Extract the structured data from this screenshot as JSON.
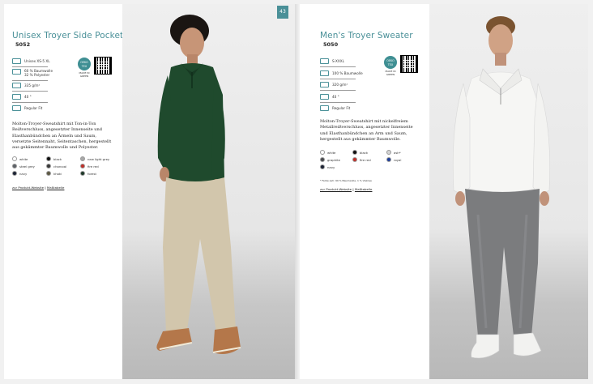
{
  "left_page": {
    "page_number": "43",
    "title": "Unisex Troyer Side Pocket",
    "code": "5052",
    "specs": [
      "Unisex XS-5 XL",
      "60 % Baumwolle 32 % Polyester",
      "335 g/m²",
      "40 °",
      "Regular Fit"
    ],
    "badge": "OEKO TEX",
    "badge_sub": "MADE IN GREEN",
    "description": "Molton-Troyer-Sweatshirt mit Ton-in-Ton Reißverschluss, angesetzter Innenseite und Elasthanbündchen an Ärmeln und Saum, versetzte Seitennaht, Seitentaschen, hergestellt aus gekämmter Baumwolle und Polyester.",
    "colors": [
      {
        "name": "white",
        "hex": "#ffffff"
      },
      {
        "name": "black",
        "hex": "#111111"
      },
      {
        "name": "new light grey",
        "hex": "#a8a8a8"
      },
      {
        "name": "steel grey",
        "hex": "#5e6268"
      },
      {
        "name": "charcoal",
        "hex": "#3a3a3a"
      },
      {
        "name": "fire red",
        "hex": "#c0302a"
      },
      {
        "name": "navy",
        "hex": "#1d2436"
      },
      {
        "name": "khaki",
        "hex": "#5e5a44"
      },
      {
        "name": "forest",
        "hex": "#1f3a2a"
      }
    ],
    "link_product": "zur Produkt-Website",
    "link_sep": "|",
    "link_size": "Maßtabelle"
  },
  "right_page": {
    "page_number": "44",
    "title": "Men's Troyer Sweater",
    "code": "5050",
    "specs": [
      "S-XXXL",
      "100 % Baumwolle",
      "320 g/m²",
      "40 °",
      "Regular Fit"
    ],
    "badge": "OEKO TEX",
    "badge_sub": "MADE IN GREEN",
    "description": "Molton-Troyer-Sweatshirt mit nickelfreiem Metallreißverschluss, angesetzter Innenseite und Elasthanbündchen an Arm und Saum, hergestellt aus gekämmter Baumwolle.",
    "colors": [
      {
        "name": "white",
        "hex": "#ffffff"
      },
      {
        "name": "black",
        "hex": "#111111"
      },
      {
        "name": "ash*",
        "hex": "#d4d4d4"
      },
      {
        "name": "graphite",
        "hex": "#4a4c50"
      },
      {
        "name": "fire red",
        "hex": "#c0302a"
      },
      {
        "name": "royal",
        "hex": "#1e3f9a"
      },
      {
        "name": "navy",
        "hex": "#1d2436"
      }
    ],
    "footnote": "* Farbe ash: 99 % Baumwolle, 1 % Viskose",
    "link_product": "zur Produkt-Website",
    "link_sep": "|",
    "link_size": "Maßtabelle"
  },
  "accent_color": "#4a9098"
}
